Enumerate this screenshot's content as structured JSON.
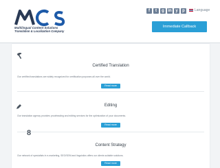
{
  "logo": {
    "letters": "MCS",
    "tagline1": "Multilingual Content Solutions",
    "tagline2": "Translation & Localization Company"
  },
  "topbar": {
    "social": [
      "f",
      "t",
      "g",
      "in",
      "y",
      "p"
    ],
    "language_label": "Language",
    "callback_label": "Immediate Callback"
  },
  "services": [
    {
      "title": "Certified Translation",
      "desc": "Our certified translations are widely recognized for certification purposes all over the world.",
      "button": "Read more",
      "icon": "gavel-icon"
    },
    {
      "title": "Editing",
      "desc": "Our translation agency provides proofreading and editing services for the optimization of your documents.",
      "button": "Read more",
      "icon": "pen-icon"
    },
    {
      "title": "Content Strategy",
      "desc": "Our network of specialists in e-marketing, SEO/SEM and linguistics offers our clients suitable solutions.",
      "button": "Read more",
      "icon": "strategy-8-icon"
    }
  ],
  "colors": {
    "accent": "#2a9fd6",
    "logo_blue": "#1d5aa8",
    "logo_dark": "#2a3a55"
  }
}
